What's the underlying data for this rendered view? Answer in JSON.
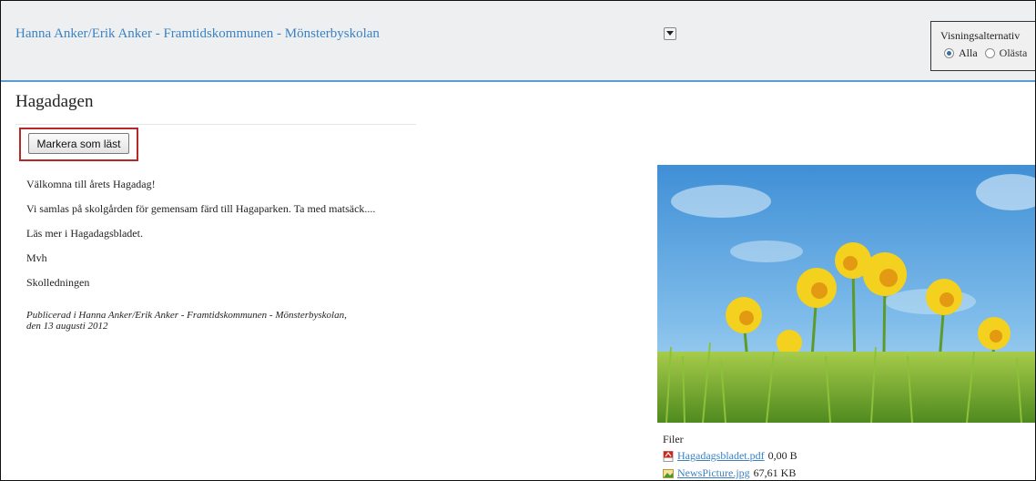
{
  "header": {
    "context_title": "Hanna Anker/Erik Anker - Framtidskommunen - Mönsterbyskolan",
    "view_options": {
      "label": "Visningsalternativ",
      "options": [
        {
          "label": "Alla",
          "selected": true
        },
        {
          "label": "Olästa",
          "selected": false
        }
      ]
    }
  },
  "article": {
    "title": "Hagadagen",
    "mark_read_label": "Markera som läst",
    "paragraphs": [
      "Välkomna till årets Hagadag!",
      "Vi samlas på skolgården för gemensam färd till Hagaparken. Ta med matsäck....",
      "Läs mer i Hagadagsbladet.",
      "Mvh",
      "Skolledningen"
    ],
    "published_line1": "Publicerad i Hanna Anker/Erik Anker - Framtidskommunen - Mönsterbyskolan,",
    "published_line2": "den 13 augusti 2012"
  },
  "files": {
    "label": "Filer",
    "items": [
      {
        "name": "Hagadagsbladet.pdf",
        "size": "0,00 B",
        "icon": "pdf-icon"
      },
      {
        "name": "NewsPicture.jpg",
        "size": "67,61 KB",
        "icon": "image-icon"
      }
    ]
  },
  "colors": {
    "link": "#3b82c4",
    "header_bg": "#eeeff0",
    "header_rule": "#5c9bd1",
    "highlight_border": "#b42a2a"
  }
}
